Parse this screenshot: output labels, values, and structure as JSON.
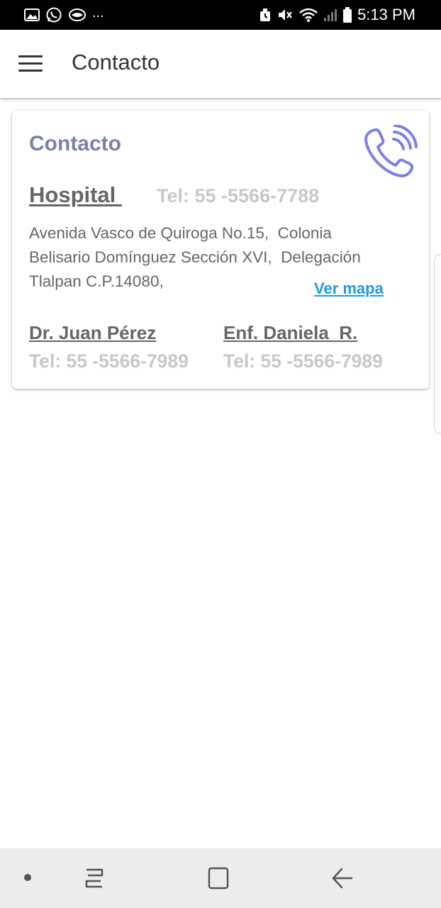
{
  "status_bar": {
    "time": "5:13 PM",
    "left_icons": [
      "gallery-icon",
      "whatsapp-icon",
      "message-icon"
    ],
    "more": "...",
    "right_icons": [
      "alarm-icon",
      "mute-icon",
      "wifi-icon",
      "signal-icon",
      "battery-icon"
    ]
  },
  "app_bar": {
    "title": "Contacto",
    "menu_icon": "hamburger-menu-icon"
  },
  "card": {
    "title": "Contacto",
    "icon": "phone-ringing-icon",
    "hospital": {
      "name": "Hospital ",
      "tel": "Tel: 55 -5566-7788",
      "address": "Avenida Vasco de Quiroga No.15,  Colonia\nBelisario Domínguez Sección XVI,  Delegación\nTlalpan C.P.14080,",
      "map_link": "Ver mapa"
    },
    "doctor": {
      "name": "Dr. Juan Pérez",
      "tel": "Tel: 55 -5566-7989"
    },
    "nurse": {
      "name": "Enf. Daniela  R.",
      "tel": "Tel: 55 -5566-7989"
    }
  },
  "colors": {
    "accent": "#7b80ad",
    "link": "#1a9be8",
    "icon": "#7b7fe8",
    "muted_text": "#c8c8c8",
    "body_text": "#666666"
  },
  "nav_bar": {
    "icons": [
      "dot-icon",
      "recent-apps-icon",
      "home-icon",
      "back-icon"
    ]
  }
}
